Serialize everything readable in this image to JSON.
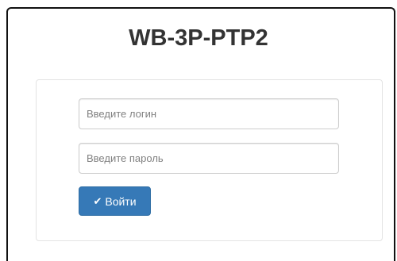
{
  "page": {
    "title": "WB-3P-PTP2"
  },
  "login_form": {
    "login_placeholder": "Введите логин",
    "password_placeholder": "Введите пароль",
    "submit_label": "Войти",
    "submit_icon": "checkmark-icon"
  },
  "colors": {
    "button_bg": "#3679b7",
    "title_text": "#333333",
    "panel_border": "#e3e3e3"
  }
}
